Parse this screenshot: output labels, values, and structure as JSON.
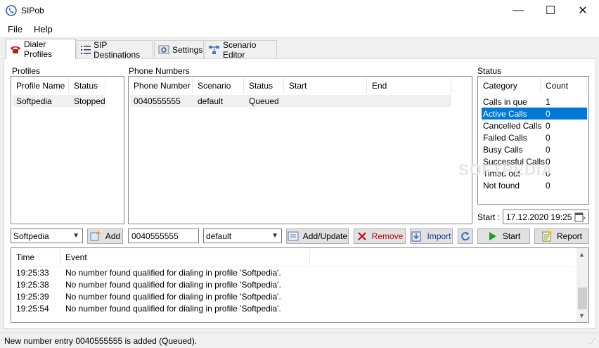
{
  "window": {
    "title": "SIPob",
    "minimize": "—",
    "maximize": "☐",
    "close": "✕"
  },
  "menu": {
    "file": "File",
    "help": "Help"
  },
  "tabs": [
    {
      "label": "Dialer Profiles"
    },
    {
      "label": "SIP Destinations"
    },
    {
      "label": "Settings"
    },
    {
      "label": "Scenario Editor"
    }
  ],
  "profiles": {
    "label": "Profiles",
    "columns": [
      "Profile Name",
      "Status"
    ],
    "rows": [
      {
        "name": "Softpedia",
        "status": "Stopped"
      }
    ]
  },
  "phone_numbers": {
    "label": "Phone Numbers",
    "columns": [
      "Phone Number",
      "Scenario",
      "Status",
      "Start",
      "End"
    ],
    "rows": [
      {
        "number": "0040555555",
        "scenario": "default",
        "status": "Queued",
        "start": "",
        "end": ""
      }
    ]
  },
  "status_panel": {
    "label": "Status",
    "columns": [
      "Category",
      "Count"
    ],
    "rows": [
      {
        "category": "Calls in que",
        "count": "1"
      },
      {
        "category": "Active Calls",
        "count": "0"
      },
      {
        "category": "Cancelled Calls",
        "count": "0"
      },
      {
        "category": "Failed Calls",
        "count": "0"
      },
      {
        "category": "Busy Calls",
        "count": "0"
      },
      {
        "category": "Successful Calls",
        "count": "0"
      },
      {
        "category": "Timed out",
        "count": "0"
      },
      {
        "category": "Not found",
        "count": "0"
      }
    ],
    "start_label": "Start :",
    "start_value": "17.12.2020 19:25"
  },
  "controls": {
    "profile_select": "Softpedia",
    "add_label": "Add",
    "number_input": "0040555555",
    "scenario_select": "default",
    "add_update_label": "Add/Update",
    "remove_label": "Remove",
    "import_label": "Import",
    "start_label": "Start",
    "report_label": "Report"
  },
  "log": {
    "columns": [
      "Time",
      "Event"
    ],
    "rows": [
      {
        "time": "19:25:33",
        "event": "No number found qualified for dialing in profile 'Softpedia'."
      },
      {
        "time": "19:25:38",
        "event": "No number found qualified for dialing in profile 'Softpedia'."
      },
      {
        "time": "19:25:39",
        "event": "No number found qualified for dialing in profile 'Softpedia'."
      },
      {
        "time": "19:25:54",
        "event": "No number found qualified for dialing in profile 'Softpedia'."
      }
    ]
  },
  "statusbar": {
    "text": "New number entry 0040555555 is added (Queued)."
  },
  "colors": {
    "selection": "#0078d7",
    "remove_red": "#c00000",
    "start_green": "#1e9e1e"
  },
  "watermark": "SOFTPEDIA"
}
